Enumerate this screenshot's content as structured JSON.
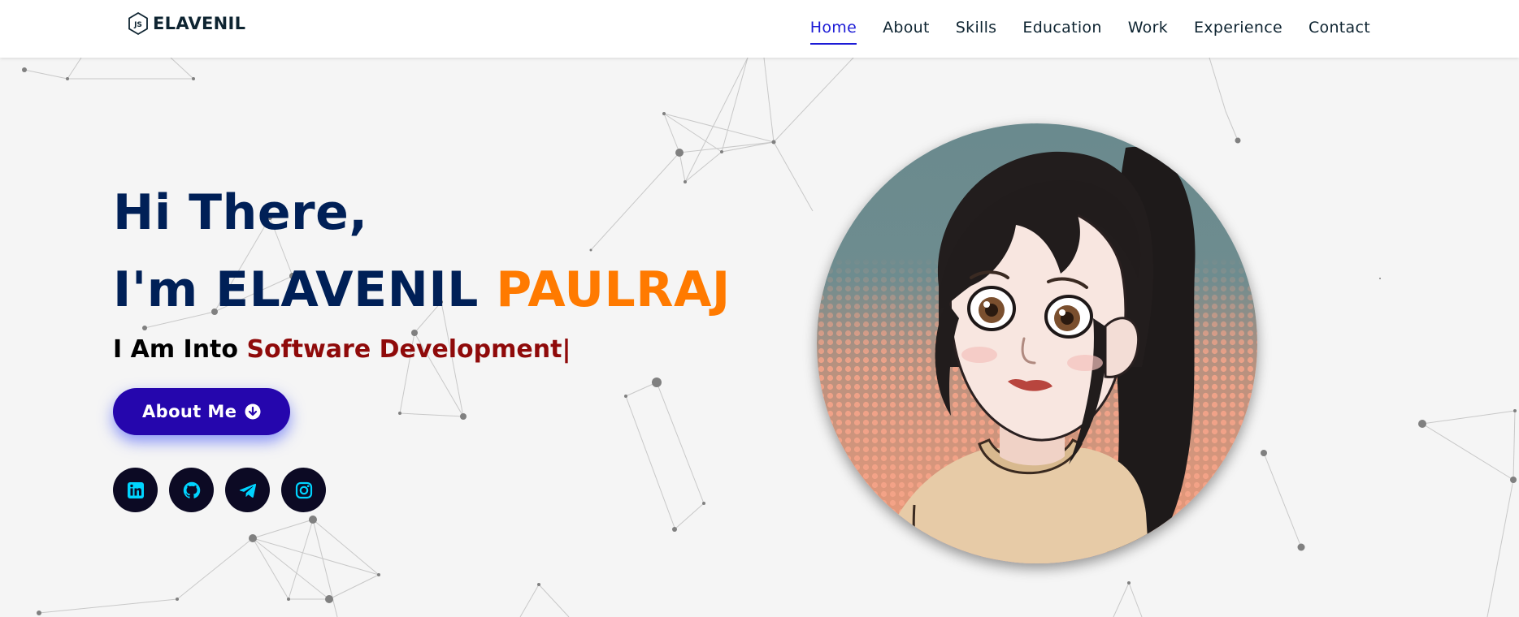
{
  "brand": {
    "logo_text": "ELAVENIL",
    "logo_icon": "js-hexagon-icon"
  },
  "nav": {
    "items": [
      {
        "label": "Home",
        "active": true
      },
      {
        "label": "About",
        "active": false
      },
      {
        "label": "Skills",
        "active": false
      },
      {
        "label": "Education",
        "active": false
      },
      {
        "label": "Work",
        "active": false
      },
      {
        "label": "Experience",
        "active": false
      },
      {
        "label": "Contact",
        "active": false
      }
    ]
  },
  "hero": {
    "greeting_line1": "Hi There,",
    "greeting_prefix": "I'm ELAVENIL",
    "greeting_lastname": "PAULRAJ",
    "typing_prefix": "I Am Into",
    "typing_role": "Software Development",
    "typing_cursor": "|",
    "button_label": "About Me",
    "button_icon": "arrow-circle-down-icon"
  },
  "socials": [
    {
      "name": "linkedin",
      "icon": "linkedin-icon"
    },
    {
      "name": "github",
      "icon": "github-icon"
    },
    {
      "name": "telegram",
      "icon": "telegram-icon"
    },
    {
      "name": "instagram",
      "icon": "instagram-icon"
    }
  ],
  "avatar": {
    "description_icon": "avatar-illustration"
  },
  "colors": {
    "nav_active": "#1c1bd6",
    "heading": "#002057",
    "accent_orange": "#ff7a00",
    "role_red": "#8f0a0a",
    "button_bg": "#2506ad",
    "social_bg": "#0c0a24",
    "social_icon": "#00d4ff"
  }
}
